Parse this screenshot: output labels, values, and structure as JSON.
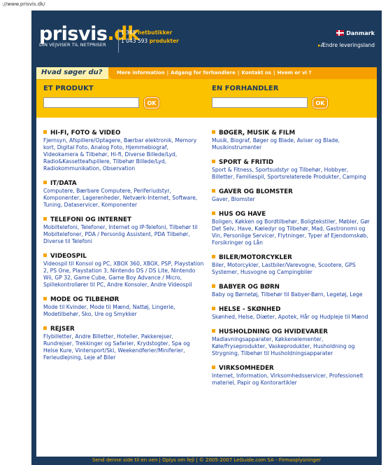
{
  "browser": {
    "url": "://www.prisvis.dk/"
  },
  "header": {
    "logo_main": "prisvis",
    "logo_tld": ".dk",
    "tagline": "DIN VEJVISER TIL NETPRISER",
    "stats_shops_num": "1 365",
    "stats_shops_label": "netbutikker",
    "stats_products_num": "1 043 593",
    "stats_products_label": "produkter",
    "country": "Danmark",
    "change_country": "Ændre leveringsland",
    "colors": {
      "navy": "#1c3a5c",
      "accent": "#f7b500",
      "orange": "#f5a000"
    }
  },
  "search": {
    "ask_label": "Hvad søger du?",
    "top_links": [
      "Mere information",
      "Adgang for forhandlere",
      "Kontakt os",
      "Hvem er vi ?"
    ],
    "product_label": "ET PRODUKT",
    "dealer_label": "EN FORHANDLER",
    "product_value": "",
    "dealer_value": "",
    "ok_label": "OK"
  },
  "categories_left": [
    {
      "title": "HI-FI, FOTO & VIDEO",
      "links": "Fjernsyn, Afspillere/Optagere, Bærbar elektronik, Memory kort, Digital Foto, Analog Foto, Hjemmebiograf, Videokamera & Tilbehør, Hi-fi, Diverse Billede/Lyd, Radio&Kassetteafspillere, Tilbehør Billede/Lyd, Radiokommunikation, Observation"
    },
    {
      "title": "IT/DATA",
      "links": "Computere, Bærbare Computere, Periferiudstyr, Komponenter, Lagerenheder, Netværk-Internet, Software, Tuning, Dataservicer, Komponenter"
    },
    {
      "title": "TELEFONI OG INTERNET",
      "links": "Mobiltelefoni, Telefoner, Internet og IP-Telefoni, Tilbehør til Mobiltelefoner, PDA / Personlig Assistent, PDA Tilbehør, Diverse til Telefoni"
    },
    {
      "title": "VIDEOSPIL",
      "links": "Videospil til Konsol og PC, XBOX 360, XBOX, PSP, Playstation 2, PS One, Playstation 3, Nintendo DS / DS Lite, Nintendo Wii, GP 32, Game Cube, Game Boy Advance / Micro, Spillekontrollører til PC, Andre Konsoler, Andre Videospil"
    },
    {
      "title": "MODE OG TILBEHØR",
      "links": "Mode til Kvinder, Mode til Mænd, Nattøj, Lingerie, Modetilbehør, Sko, Ure og Smykker"
    },
    {
      "title": "REJSER",
      "links": "Flybilletter, Andre Billetter, Hoteller, Pakkerejser, Rundrejser, Trekkinger og Safarier, Krydstogter, Spa og Helse Kure, Vintersport/Ski, Weekendferier/Miniferier, Ferieudlejning, Leje af Biler"
    }
  ],
  "categories_right": [
    {
      "title": "BØGER, MUSIK & FILM",
      "links": "Musik, Biograf, Bøger og Blade, Aviser og Blade, Musikinstrumenter"
    },
    {
      "title": "SPORT & FRITID",
      "links": "Sport & Fitness, Sportsudstyr og Tilbehør, Hobbyer, Billetter, Familiespil, Sportsrelaterede Produkter, Camping"
    },
    {
      "title": "GAVER OG BLOMSTER",
      "links": "Gaver, Blomster"
    },
    {
      "title": "HUS OG HAVE",
      "links": "Boligen, Køkken og Bordtilbehør, Boligtekstiler, Møbler, Gør Det Selv, Have, Kæledyr og Tilbehør, Mad, Gastronomi og Vin, Personlige Servicer, Flytninger, Typer af Ejendomskøb, Forsikringer og Lån"
    },
    {
      "title": "BILER/MOTORCYKLER",
      "links": "Biler, Motorcykler, Lastbiler/Varevogne, Scootere, GPS Systemer, Husvogne og Campingbiler"
    },
    {
      "title": "BABYER OG BØRN",
      "links": "Baby og Børnetøj, Tilbehør til Babyer-Børn, Legetøj, Lege"
    },
    {
      "title": "HELSE - SKØNHED",
      "links": "Skønhed, Helse, Diæter, Apotek, Hår og Hudpleje til Mænd"
    },
    {
      "title": "HUSHOLDNING OG HVIDEVARER",
      "links": "Madlavningsapparater, Køkkenelementer, Køle/Fryseprodukter, Vaskeprodukter, Husholdning og Strygning, Tilbehør til Husholdningsapparater"
    },
    {
      "title": "VIRKSOMHEDER",
      "links": "Internet, Information, Virksomhedsservicer, Professionelt materiel, Papir og Kontorartikler"
    }
  ],
  "footer": {
    "text": "Send denne side til en ven | Oplys om fejl | © 2005-2007 LeGuide.com SA - Firmaoplysninger"
  }
}
